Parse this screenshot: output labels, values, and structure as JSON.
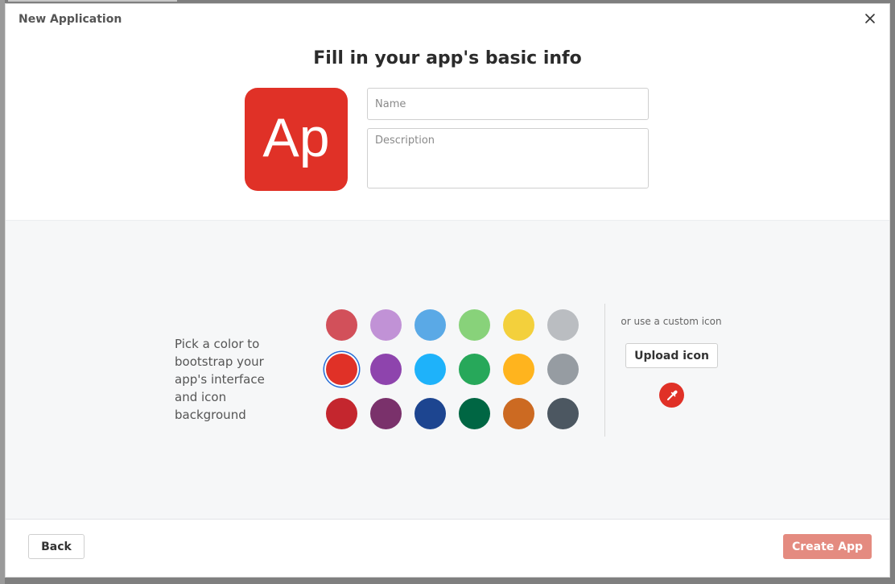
{
  "dialog": {
    "title": "New Application",
    "close_icon": "close-icon"
  },
  "main": {
    "heading": "Fill in your app's basic info",
    "app_icon": {
      "initials": "Ap",
      "background": "#e03127",
      "text_color": "#ffffff"
    },
    "name_field": {
      "value": "",
      "placeholder": "Name"
    },
    "description_field": {
      "value": "",
      "placeholder": "Description"
    }
  },
  "color_picker": {
    "instructions": "Pick a color to bootstrap your app's interface and icon background",
    "selected": "#e03127",
    "swatches": [
      [
        "#d2505a",
        "#c192d6",
        "#5aa9e6",
        "#88d27a",
        "#f3d03c",
        "#babdc1"
      ],
      [
        "#e03127",
        "#8e44ad",
        "#1eb2fa",
        "#27a85a",
        "#ffb41e",
        "#969ca2"
      ],
      [
        "#c4262e",
        "#7a316b",
        "#1d4590",
        "#006643",
        "#cc6a22",
        "#4c5761"
      ]
    ],
    "custom_icon_label": "or use a custom icon",
    "upload_button_label": "Upload icon",
    "eyedropper_icon": "eyedropper-icon",
    "eyedropper_color": "#e03127"
  },
  "footer": {
    "back_label": "Back",
    "create_label": "Create App",
    "create_color": "#e48b80"
  }
}
